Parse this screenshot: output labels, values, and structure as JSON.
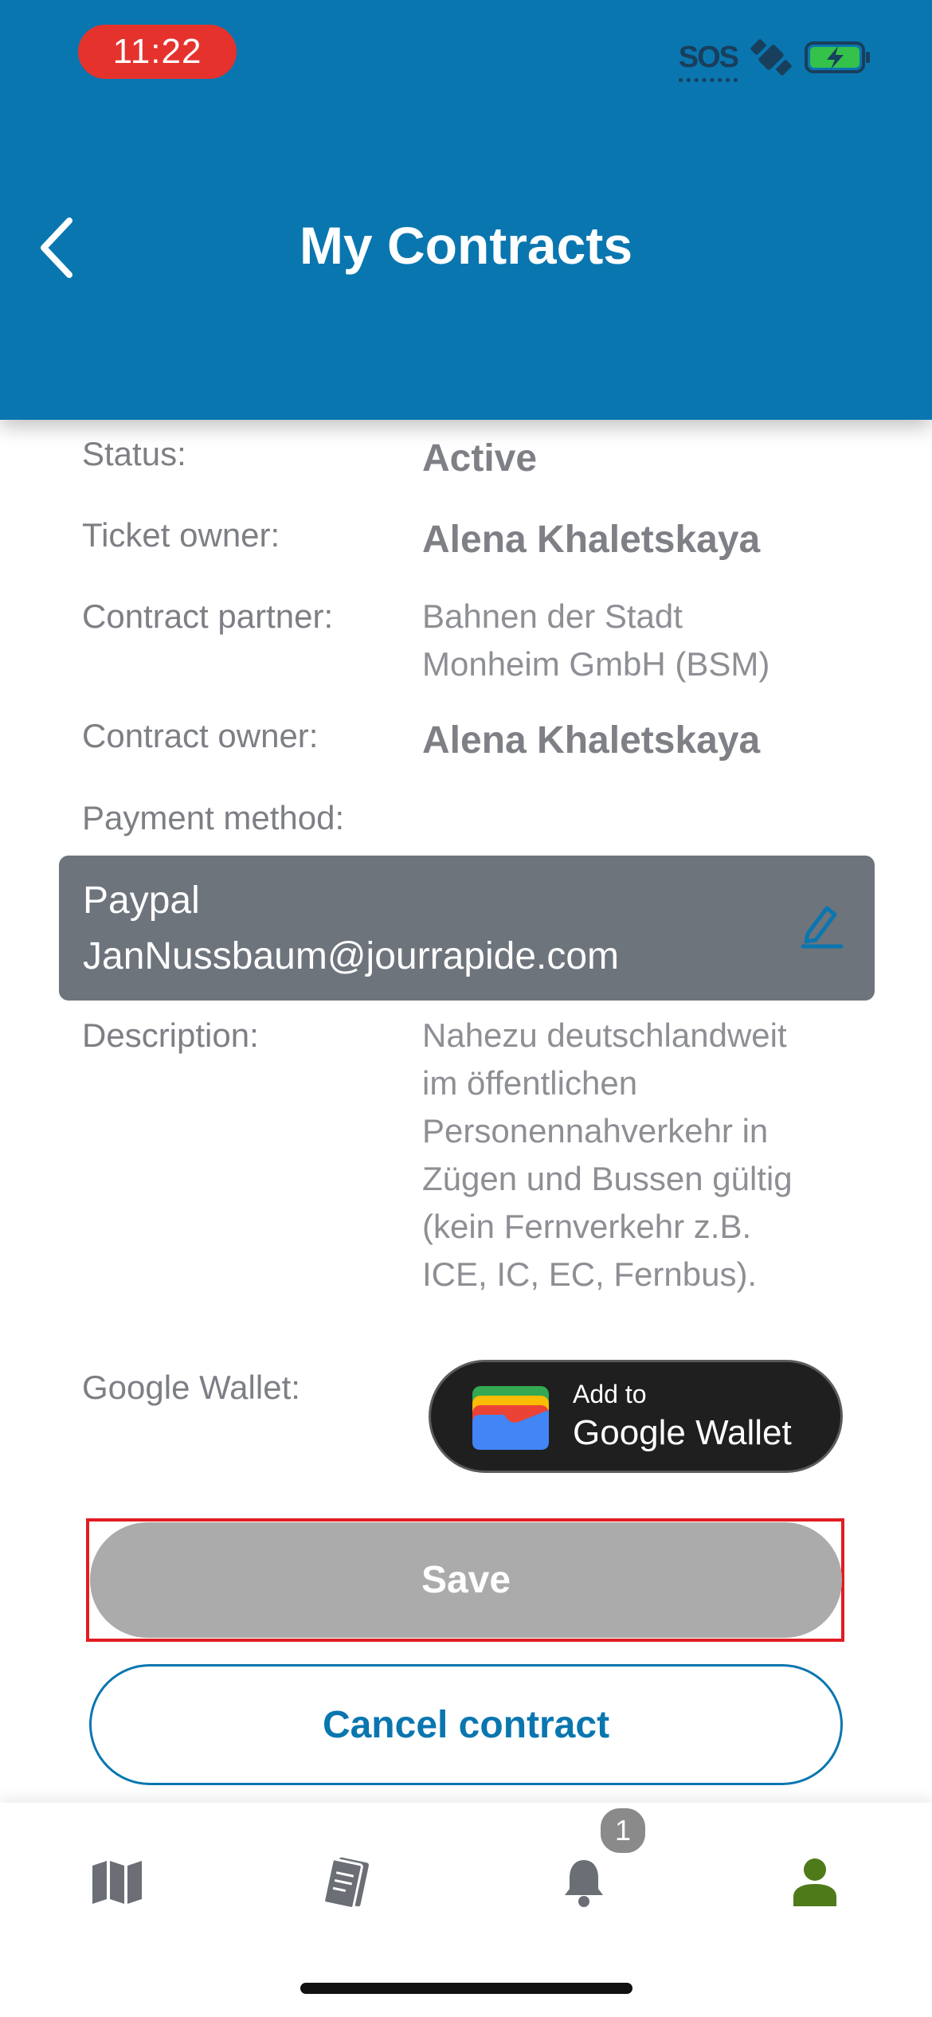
{
  "status_bar": {
    "time": "11:22",
    "sos_label": "SOS",
    "icons": [
      "satellite-icon",
      "battery-charging-icon"
    ]
  },
  "header": {
    "title": "My Contracts",
    "back_icon": "chevron-left-icon"
  },
  "details": {
    "status_label": "Status:",
    "status_value": "Active",
    "ticket_owner_label": "Ticket owner:",
    "ticket_owner_value": "Alena Khaletskaya",
    "contract_partner_label": "Contract partner:",
    "contract_partner_line1": "Bahnen der Stadt",
    "contract_partner_line2": "Monheim GmbH (BSM)",
    "contract_owner_label": "Contract owner:",
    "contract_owner_value": "Alena Khaletskaya",
    "payment_method_label": "Payment method:",
    "payment_type": "Paypal",
    "payment_account": "JanNussbaum@jourrapide.com",
    "description_label": "Description:",
    "description_lines": [
      "Nahezu deutschlandweit",
      "im öffentlichen",
      "Personennahverkehr in",
      "Zügen und Bussen gültig",
      "(kein Fernverkehr z.B.",
      "ICE, IC, EC, Fernbus)."
    ],
    "google_wallet_label": "Google Wallet:",
    "wallet_small": "Add to",
    "wallet_big": "Google Wallet"
  },
  "actions": {
    "save_label": "Save",
    "cancel_label": "Cancel contract"
  },
  "bottom_nav": {
    "items": [
      {
        "icon": "map-icon"
      },
      {
        "icon": "tickets-icon"
      },
      {
        "icon": "bell-icon",
        "badge": "1"
      },
      {
        "icon": "profile-icon",
        "active": true
      }
    ]
  },
  "colors": {
    "header_bg": "#0a76b0",
    "accent": "#0a76b0",
    "time_pill": "#e5322d",
    "save_disabled": "#ababab",
    "profile_active": "#4f7a1a"
  }
}
